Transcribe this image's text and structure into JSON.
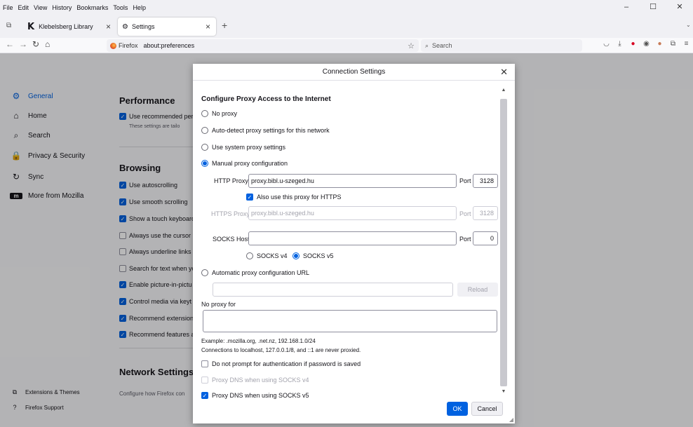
{
  "menubar": [
    "File",
    "Edit",
    "View",
    "History",
    "Bookmarks",
    "Tools",
    "Help"
  ],
  "window_controls": {
    "minimize": "–",
    "maximize": "☐",
    "close": "✕"
  },
  "tabs": [
    {
      "title": "Klebelsberg Library",
      "favicon": "K"
    },
    {
      "title": "Settings"
    }
  ],
  "navbar": {
    "browser_chip": "Firefox",
    "url": "about:preferences",
    "search_placeholder": "Search"
  },
  "sidebar": {
    "items": [
      {
        "label": "General",
        "icon": "gear-icon",
        "active": true
      },
      {
        "label": "Home",
        "icon": "home-icon"
      },
      {
        "label": "Search",
        "icon": "search-icon"
      },
      {
        "label": "Privacy & Security",
        "icon": "lock-icon"
      },
      {
        "label": "Sync",
        "icon": "sync-icon"
      },
      {
        "label": "More from Mozilla",
        "icon": "mozilla-icon"
      }
    ],
    "bottom": [
      {
        "label": "Extensions & Themes",
        "icon": "puzzle-icon"
      },
      {
        "label": "Firefox Support",
        "icon": "help-icon"
      }
    ]
  },
  "prefs": {
    "performance_heading": "Performance",
    "performance_option": "Use recommended per",
    "performance_sub": "These settings are tailo",
    "browsing_heading": "Browsing",
    "browsing_options": [
      {
        "label": "Use autoscrolling",
        "checked": true
      },
      {
        "label": "Use smooth scrolling",
        "checked": true
      },
      {
        "label": "Show a touch keyboard",
        "checked": true
      },
      {
        "label": "Always use the cursor k",
        "checked": false
      },
      {
        "label": "Always underline links",
        "checked": false
      },
      {
        "label": "Search for text when yo",
        "checked": false
      },
      {
        "label": "Enable picture-in-pictu",
        "checked": true
      },
      {
        "label": "Control media via keyt",
        "checked": true
      },
      {
        "label": "Recommend extension",
        "checked": true
      },
      {
        "label": "Recommend features a",
        "checked": true
      }
    ],
    "network_heading": "Network Settings",
    "network_sub": "Configure how Firefox con"
  },
  "dialog": {
    "title": "Connection Settings",
    "heading": "Configure Proxy Access to the Internet",
    "radio_no_proxy": "No proxy",
    "radio_auto_detect": "Auto-detect proxy settings for this network",
    "radio_system": "Use system proxy settings",
    "radio_manual": "Manual proxy configuration",
    "http_proxy_label": "HTTP Proxy",
    "http_proxy_value": "proxy.bibl.u-szeged.hu",
    "port_label": "Port",
    "http_port_value": "3128",
    "also_https_label": "Also use this proxy for HTTPS",
    "https_proxy_label": "HTTPS Proxy",
    "https_proxy_value": "proxy.bibl.u-szeged.hu",
    "https_port_value": "3128",
    "socks_host_label": "SOCKS Host",
    "socks_host_value": "",
    "socks_port_value": "0",
    "socks_v4_label": "SOCKS v4",
    "socks_v5_label": "SOCKS v5",
    "radio_auto_url": "Automatic proxy configuration URL",
    "auto_url_value": "",
    "reload_label": "Reload",
    "no_proxy_label": "No proxy for",
    "no_proxy_value": "",
    "example_text": "Example: .mozilla.org, .net.nz, 192.168.1.0/24",
    "localhost_text": "Connections to localhost, 127.0.0.1/8, and ::1 are never proxied.",
    "no_prompt_auth_label": "Do not prompt for authentication if password is saved",
    "dns_v4_label": "Proxy DNS when using SOCKS v4",
    "dns_v5_label": "Proxy DNS when using SOCKS v5",
    "ok_label": "OK",
    "cancel_label": "Cancel"
  },
  "colors": {
    "accent": "#0061e0",
    "overlay": "#000000"
  }
}
